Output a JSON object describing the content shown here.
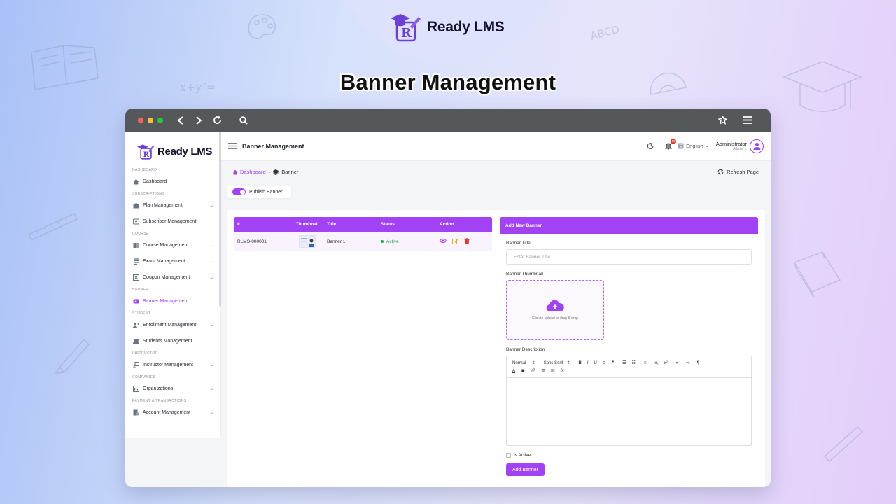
{
  "brand": {
    "name": "Ready LMS",
    "logo_letter": "R"
  },
  "page_heading": "Banner Management",
  "app": {
    "title": "Banner Management",
    "language": "English",
    "user": {
      "name": "Administrator",
      "role": "Admin"
    },
    "notification_count": "10"
  },
  "sidebar": {
    "sections": [
      {
        "label": "DASHBOARD",
        "items": [
          {
            "label": "Dashboard",
            "icon": "home-icon",
            "chevron": false
          }
        ]
      },
      {
        "label": "SUBSCRIPTIONS",
        "items": [
          {
            "label": "Plan Management",
            "icon": "plan-icon",
            "chevron": true
          },
          {
            "label": "Subscriber Management",
            "icon": "subscriber-icon",
            "chevron": false
          }
        ]
      },
      {
        "label": "COURSE",
        "items": [
          {
            "label": "Course Management",
            "icon": "book-icon",
            "chevron": true
          },
          {
            "label": "Exam Management",
            "icon": "exam-icon",
            "chevron": true
          },
          {
            "label": "Coupon Management",
            "icon": "coupon-icon",
            "chevron": true
          }
        ]
      },
      {
        "label": "BANNER",
        "items": [
          {
            "label": "Banner Management",
            "icon": "banner-icon",
            "chevron": false,
            "active": true
          }
        ]
      },
      {
        "label": "STUDENT",
        "items": [
          {
            "label": "Enrollment Management",
            "icon": "enrollment-icon",
            "chevron": true
          },
          {
            "label": "Students Management",
            "icon": "students-icon",
            "chevron": false
          }
        ]
      },
      {
        "label": "INSTRUCTOR",
        "items": [
          {
            "label": "Instructor Management",
            "icon": "instructor-icon",
            "chevron": true
          }
        ]
      },
      {
        "label": "COMPANIES",
        "items": [
          {
            "label": "Organizations",
            "icon": "organization-icon",
            "chevron": true
          }
        ]
      },
      {
        "label": "PAYMENT & TRANSACTIONS",
        "items": [
          {
            "label": "Account Management",
            "icon": "account-icon",
            "chevron": true
          }
        ]
      }
    ]
  },
  "breadcrumb": {
    "home": "Dashboard",
    "current": "Banner"
  },
  "refresh_label": "Refresh Page",
  "publish_label": "Publish Banner",
  "table": {
    "headers": [
      "#",
      "Thumbnail",
      "Title",
      "Status",
      "Action"
    ],
    "rows": [
      {
        "id": "RLMS-000001",
        "title": "Banner 1",
        "status": "Active"
      }
    ]
  },
  "form": {
    "header": "Add New Banner",
    "title_label": "Banner Title",
    "title_placeholder": "Enter Banner Title",
    "thumbnail_label": "Banner Thumbnail",
    "upload_text": "Click to upload or drag & drop",
    "description_label": "Banner Description",
    "editor": {
      "format": "Normal",
      "font": "Sans Serif"
    },
    "active_label": "Is Active",
    "submit_label": "Add Banner"
  },
  "colors": {
    "accent": "#a142f4",
    "chrome": "#55585b",
    "success": "#22a34b",
    "danger": "#e53935"
  }
}
